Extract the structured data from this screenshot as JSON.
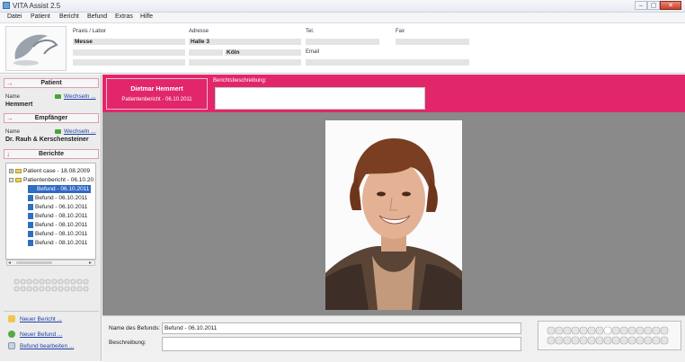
{
  "window": {
    "title": "VITA Assist 2.5",
    "min": "–",
    "max": "▢",
    "close": "✕"
  },
  "menu": [
    "Datei",
    "Patient",
    "Bericht",
    "Befund",
    "Extras",
    "Hilfe"
  ],
  "header": {
    "labels": {
      "praxis": "Praxis / Labor",
      "adresse": "Adresse",
      "tel": "Tel.",
      "fax": "Fax",
      "email": "Email"
    },
    "values": {
      "praxis": "Messe",
      "adresse": "Halle 3",
      "city": "Köln"
    }
  },
  "left": {
    "patient": {
      "title": "Patient",
      "name_label": "Name",
      "change_link": "Wechseln ...",
      "name": "Hemmert"
    },
    "recipient": {
      "title": "Empfänger",
      "name_label": "Name",
      "change_link": "Wechseln ...",
      "name": "Dr. Rauh & Kerschensteiner"
    },
    "reports": {
      "title": "Berichte",
      "tree": [
        {
          "label": "Patient case - 18.08.2009",
          "level": 0,
          "kind": "folder",
          "expander": "+"
        },
        {
          "label": "Patientenbericht - 06.10.20",
          "level": 0,
          "kind": "folder",
          "expander": "−"
        },
        {
          "label": "Befund - 06.10.2011",
          "level": 1,
          "kind": "doc",
          "selected": true
        },
        {
          "label": "Befund - 06.10.2011",
          "level": 1,
          "kind": "doc"
        },
        {
          "label": "Befund - 06.10.2011",
          "level": 1,
          "kind": "doc"
        },
        {
          "label": "Befund - 08.10.2011",
          "level": 1,
          "kind": "doc"
        },
        {
          "label": "Befund - 08.10.2011",
          "level": 1,
          "kind": "doc"
        },
        {
          "label": "Befund - 08.10.2011",
          "level": 1,
          "kind": "doc"
        },
        {
          "label": "Befund - 08.10.2011",
          "level": 1,
          "kind": "doc"
        }
      ]
    },
    "actions": {
      "new_report": "Neuer Bericht ...",
      "new_finding": "Neuer Befund ...",
      "edit_finding": "Befund bearbeiten ..."
    }
  },
  "main": {
    "patient_name": "Dietmar Hemmert",
    "report_subtitle": "Patientenbericht - 06.10.2011",
    "description_label": "Berichtsbeschreibung:",
    "finding_name_label": "Name des Befunds:",
    "finding_name_value": "Befund - 06.10.2011",
    "description_field_label": "Beschreibung:"
  },
  "colors": {
    "accent": "#e2266a",
    "link": "#1f3fa8",
    "selection": "#3168c6"
  }
}
